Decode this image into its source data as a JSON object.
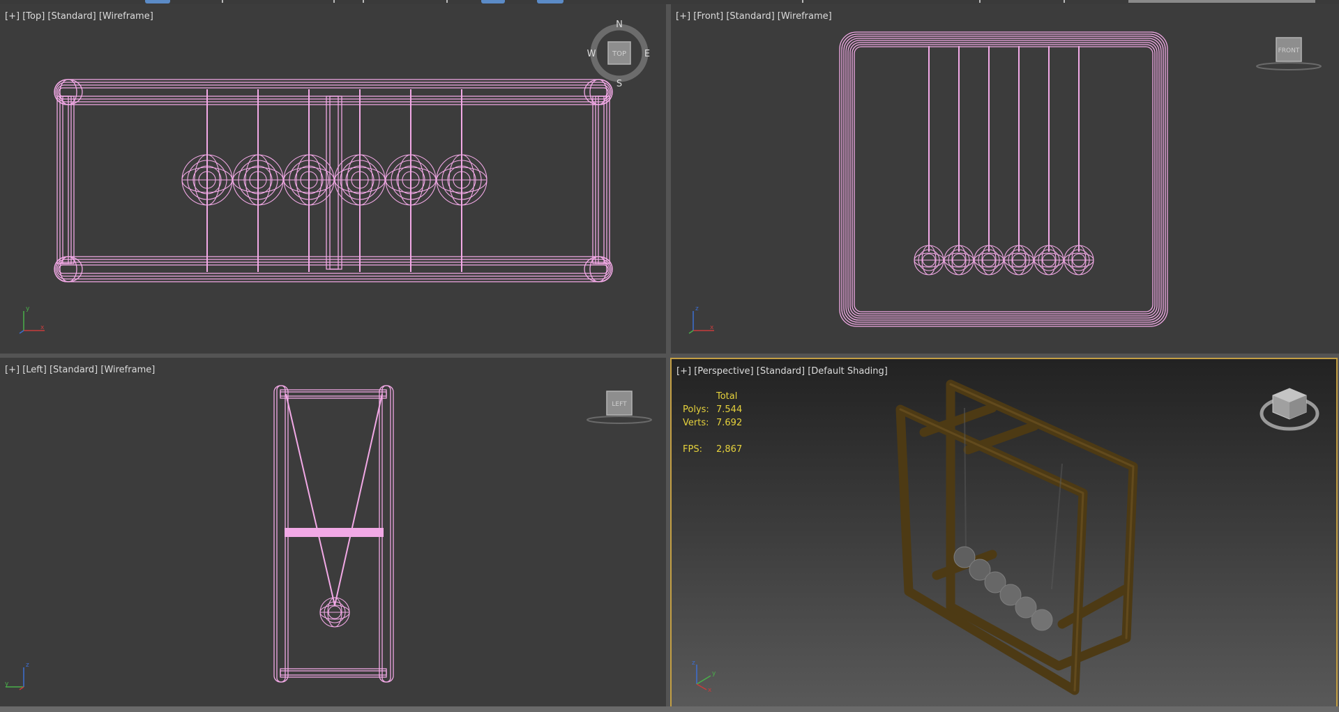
{
  "viewports": {
    "top": {
      "menu": "[+]",
      "view": "[Top]",
      "preset": "[Standard]",
      "shading": "[Wireframe]",
      "compass": {
        "n": "N",
        "s": "S",
        "e": "E",
        "w": "W",
        "cube_label": "TOP"
      },
      "axes": {
        "vertical": "y",
        "horizontal": "x"
      }
    },
    "front": {
      "menu": "[+]",
      "view": "[Front]",
      "preset": "[Standard]",
      "shading": "[Wireframe]",
      "cube_label": "FRONT",
      "axes": {
        "vertical": "z",
        "horizontal": "x"
      }
    },
    "left": {
      "menu": "[+]",
      "view": "[Left]",
      "preset": "[Standard]",
      "shading": "[Wireframe]",
      "cube_label": "LEFT",
      "axes": {
        "vertical": "z",
        "horizontal": "y"
      }
    },
    "perspective": {
      "menu": "[+]",
      "view": "[Perspective]",
      "preset": "[Standard]",
      "shading": "[Default Shading]",
      "stats": {
        "header": "Total",
        "polys_label": "Polys:",
        "polys": "7.544",
        "verts_label": "Verts:",
        "verts": "7.692",
        "fps_label": "FPS:",
        "fps": "2,867"
      },
      "axes": {
        "vertical": "z",
        "depth": "y",
        "horizontal": "x"
      }
    }
  },
  "colors": {
    "wireframe": "#f2a9e6",
    "viewport_bg": "#3c3c3c",
    "active_border": "#c4a044",
    "stats_text": "#e6d23c",
    "frame_shaded": "#4d3a14",
    "spheres_shaded": "#6a6a6a"
  }
}
